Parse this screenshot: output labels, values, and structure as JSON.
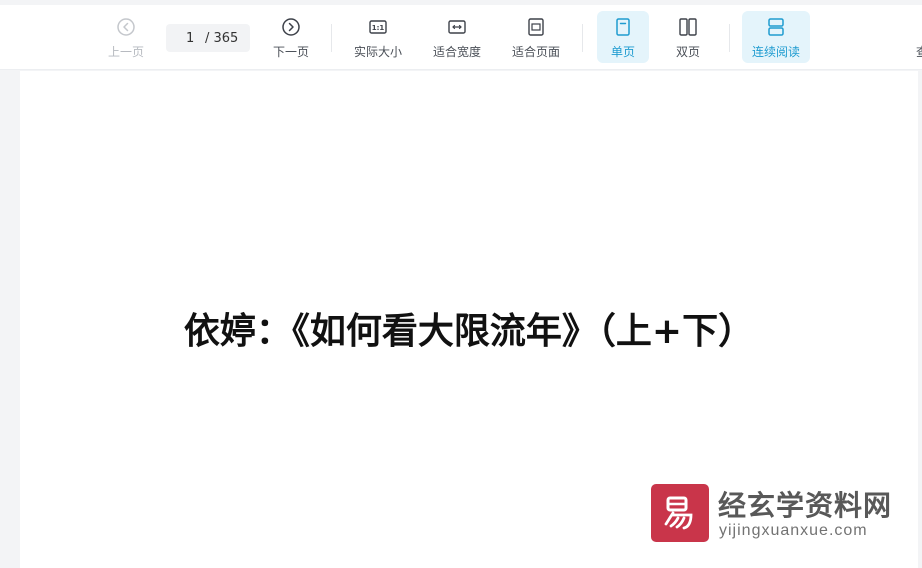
{
  "toolbar": {
    "prev_label": "上一页",
    "page_current": "1",
    "page_total": "/ 365",
    "next_label": "下一页",
    "actual_size_label": "实际大小",
    "fit_width_label": "适合宽度",
    "fit_page_label": "适合页面",
    "single_page_label": "单页",
    "double_page_label": "双页",
    "continuous_label": "连续阅读",
    "cut_label": "查"
  },
  "document": {
    "title": "依婷：《如何看大限流年》（上+下）"
  },
  "watermark": {
    "logo_char": "易",
    "site_name": "经玄学资料网",
    "url": "yijingxuanxue.com"
  },
  "colors": {
    "accent": "#1e9bd0",
    "active_bg": "#e4f4fb",
    "logo_bg": "#c9354a"
  }
}
